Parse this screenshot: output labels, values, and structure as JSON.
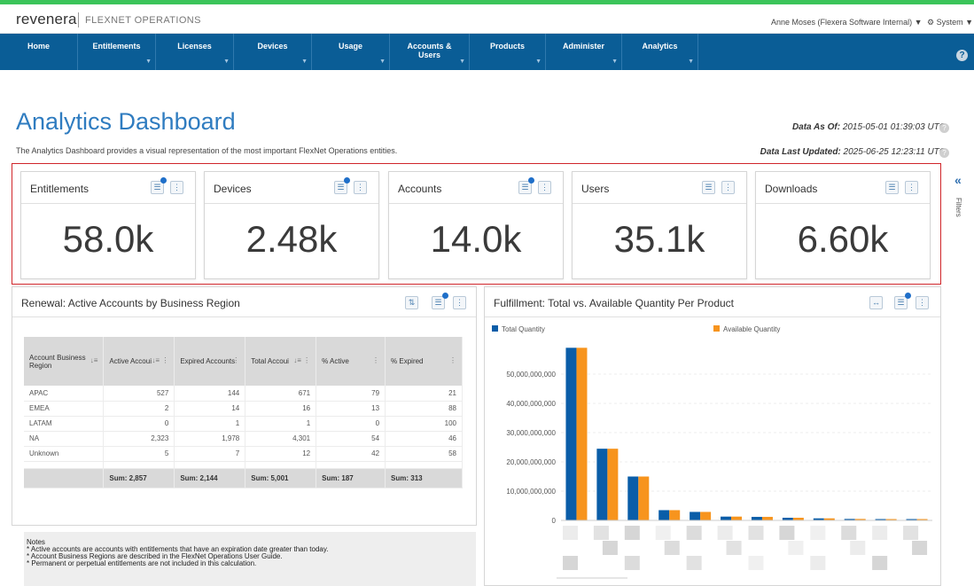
{
  "header": {
    "logo": "revenera",
    "product": "FLEXNET OPERATIONS",
    "user": "Anne Moses (Flexera Software Internal) ▼",
    "system": "System ▼"
  },
  "nav": [
    {
      "label": "Home"
    },
    {
      "label": "Entitlements"
    },
    {
      "label": "Licenses"
    },
    {
      "label": "Devices"
    },
    {
      "label": "Usage"
    },
    {
      "label": "Accounts &\nUsers"
    },
    {
      "label": "Products"
    },
    {
      "label": "Administer"
    },
    {
      "label": "Analytics"
    }
  ],
  "page": {
    "title": "Analytics Dashboard",
    "description": "The Analytics Dashboard provides a visual representation of the most important FlexNet Operations entities.",
    "data_as_of_label": "Data As Of:",
    "data_as_of_value": "2015-05-01 01:39:03 UTC",
    "data_updated_label": "Data Last Updated:",
    "data_updated_value": "2025-06-25 12:23:11 UTC"
  },
  "kpis": [
    {
      "title": "Entitlements",
      "value": "58.0k",
      "filtered": true
    },
    {
      "title": "Devices",
      "value": "2.48k",
      "filtered": true
    },
    {
      "title": "Accounts",
      "value": "14.0k",
      "filtered": true
    },
    {
      "title": "Users",
      "value": "35.1k",
      "filtered": false
    },
    {
      "title": "Downloads",
      "value": "6.60k",
      "filtered": false
    }
  ],
  "filters_rail": {
    "label": "Filters"
  },
  "renewal": {
    "title": "Renewal: Active Accounts by Business Region",
    "columns": [
      "Account Business Region",
      "Active Accoui",
      "Expired Accounts",
      "Total Accoui",
      "% Active",
      "% Expired"
    ],
    "rows": [
      [
        "APAC",
        "527",
        "144",
        "671",
        "79",
        "21"
      ],
      [
        "EMEA",
        "2",
        "14",
        "16",
        "13",
        "88"
      ],
      [
        "LATAM",
        "0",
        "1",
        "1",
        "0",
        "100"
      ],
      [
        "NA",
        "2,323",
        "1,978",
        "4,301",
        "54",
        "46"
      ],
      [
        "Unknown",
        "5",
        "7",
        "12",
        "42",
        "58"
      ]
    ],
    "sums": [
      "",
      "Sum: 2,857",
      "Sum: 2,144",
      "Sum: 5,001",
      "Sum: 187",
      "Sum: 313"
    ]
  },
  "notes": {
    "heading": "Notes",
    "lines": [
      "* Active accounts are accounts with entitlements that have an expiration date greater than today.",
      "* Account Business Regions are described in the FlexNet Operations User Guide.",
      "* Permanent or perpetual entitlements are not included in this calculation."
    ]
  },
  "fulfillment": {
    "title": "Fulfillment: Total vs. Available Quantity Per Product"
  },
  "colors": {
    "nav_bg": "#0a5d96",
    "accent_green": "#3bc45a",
    "title_blue": "#2f7cc0",
    "highlight_red": "#d0252a",
    "series_total": "#0a5da8",
    "series_available": "#f7941d"
  },
  "chart_data": {
    "type": "bar",
    "title": "Fulfillment: Total vs. Available Quantity Per Product",
    "categories": [
      "",
      "",
      "",
      "",
      "",
      "",
      "",
      "",
      "",
      "",
      "",
      ""
    ],
    "series": [
      {
        "name": "Total Quantity",
        "values": [
          59000000000,
          24500000000,
          15000000000,
          3500000000,
          2900000000,
          1300000000,
          1200000000,
          900000000,
          700000000,
          500000000,
          400000000,
          300000000
        ]
      },
      {
        "name": "Available Quantity",
        "values": [
          59000000000,
          24500000000,
          15000000000,
          3500000000,
          2900000000,
          1300000000,
          1200000000,
          900000000,
          700000000,
          500000000,
          400000000,
          300000000
        ]
      }
    ],
    "yticks": [
      "0",
      "10,000,000,000",
      "20,000,000,000",
      "30,000,000,000",
      "40,000,000,000",
      "50,000,000,000"
    ],
    "ylim": [
      0,
      60000000000
    ],
    "legend": "top",
    "grid": true
  }
}
